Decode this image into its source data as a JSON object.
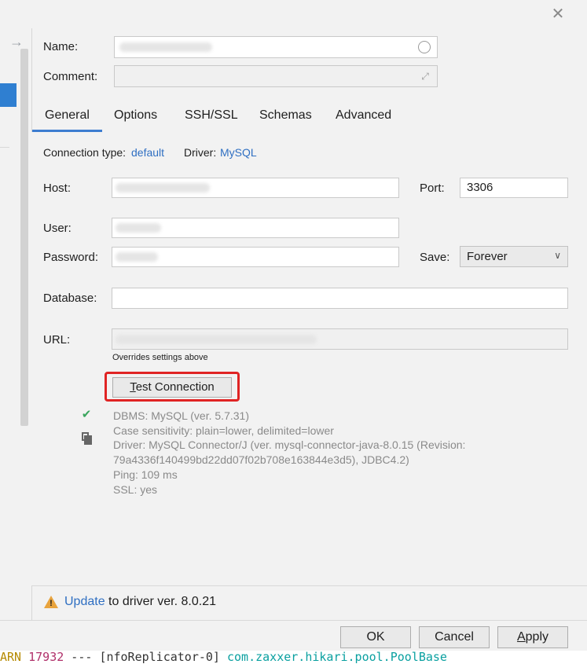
{
  "dialog": {
    "name_label": "Name:",
    "comment_label": "Comment:"
  },
  "tabs": [
    {
      "label": "General",
      "active": true
    },
    {
      "label": "Options",
      "active": false
    },
    {
      "label": "SSH/SSL",
      "active": false
    },
    {
      "label": "Schemas",
      "active": false
    },
    {
      "label": "Advanced",
      "active": false
    }
  ],
  "general": {
    "connection_type_label": "Connection type:",
    "connection_type_value": "default",
    "driver_label": "Driver:",
    "driver_value": "MySQL",
    "host_label": "Host:",
    "port_label": "Port:",
    "port_value": "3306",
    "user_label": "User:",
    "password_label": "Password:",
    "save_label": "Save:",
    "save_value": "Forever",
    "database_label": "Database:",
    "url_label": "URL:",
    "url_hint": "Overrides settings above",
    "test_connection_label": "Test Connection"
  },
  "result": {
    "line1": "DBMS: MySQL (ver. 5.7.31)",
    "line2": "Case sensitivity: plain=lower, delimited=lower",
    "line3": "Driver: MySQL Connector/J (ver. mysql-connector-java-8.0.15 (Revision:",
    "line4": "79a4336f140499bd22dd07f02b708e163844e3d5), JDBC4.2)",
    "line5": "Ping: 109 ms",
    "line6": "SSL: yes"
  },
  "footer": {
    "update_link": "Update",
    "update_text": " to driver ver. 8.0.21",
    "ok_label": "OK",
    "cancel_label": "Cancel",
    "apply_label": "Apply"
  },
  "console": {
    "prefix": "ARN",
    "pid": "17932",
    "dashes": " --- ",
    "thread": "[nfoReplicator-0]",
    "logger": "com.zaxxer.hikari.pool.PoolBase"
  },
  "colors": {
    "accent": "#3d7dd0",
    "link": "#2f6fc2",
    "highlight": "#e02424",
    "success": "#3aa55d",
    "warning": "#e8a33d"
  },
  "icons": [
    "arrow-right-icon",
    "close-icon",
    "circle-icon",
    "expand-icon",
    "chevron-down-icon",
    "check-icon",
    "copy-icon",
    "warning-icon"
  ]
}
